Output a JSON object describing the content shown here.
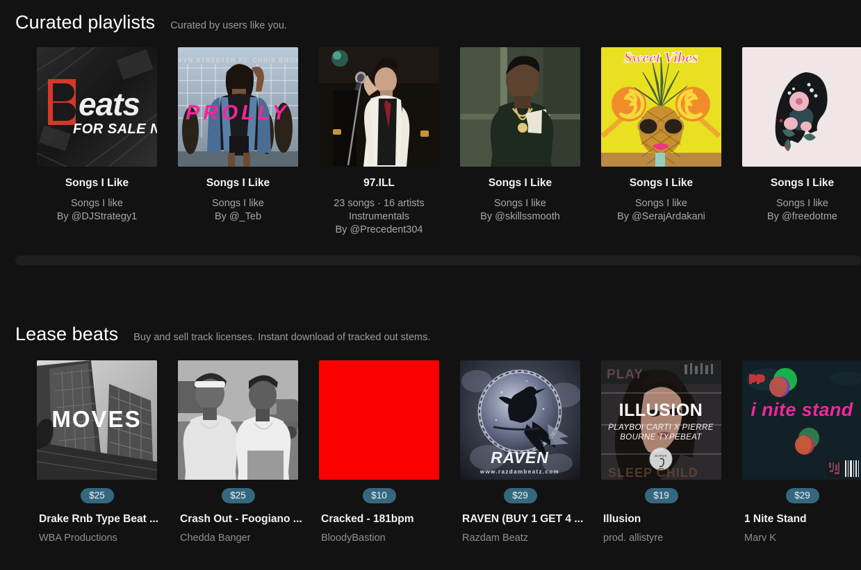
{
  "sections": {
    "curated": {
      "title": "Curated playlists",
      "subtitle": "Curated by users like you."
    },
    "lease": {
      "title": "Lease beats",
      "subtitle": "Buy and sell track licenses. Instant download of tracked out stems."
    }
  },
  "playlists": [
    {
      "title": "Songs I Like",
      "meta_line1": "Songs I like",
      "meta_line2": "By @DJStrategy1",
      "meta_line3": "",
      "art_name": "beats-for-sale-now-cover",
      "art_text": "Beats FOR SALE NOW"
    },
    {
      "title": "Songs I Like",
      "meta_line1": "Songs I like",
      "meta_line2": "By @_Teb",
      "meta_line3": "",
      "art_name": "prolly-sevyn-streeter-cover",
      "art_text": "PROLLY"
    },
    {
      "title": "97.ILL",
      "meta_line1": "23 songs · 16 artists",
      "meta_line2": "Instrumentals",
      "meta_line3": "By @Precedent304",
      "art_name": "singer-with-microphone-cover",
      "art_text": ""
    },
    {
      "title": "Songs I Like",
      "meta_line1": "Songs I like",
      "meta_line2": "By @skillssmooth",
      "meta_line3": "",
      "art_name": "rapper-with-cash-cover",
      "art_text": ""
    },
    {
      "title": "Songs I Like",
      "meta_line1": "Songs I like",
      "meta_line2": "By @SerajArdakani",
      "meta_line3": "",
      "art_name": "sweet-vibes-pineapple-cover",
      "art_text": "Sweet Vibes"
    },
    {
      "title": "Songs I Like",
      "meta_line1": "Songs I like",
      "meta_line2": "By @freedotme",
      "meta_line3": "",
      "art_name": "floral-silhouette-cover",
      "art_text": ""
    }
  ],
  "beats": [
    {
      "price": "$25",
      "title": "Drake Rnb Type Beat ...",
      "artist": "WBA Productions",
      "art_name": "moves-skyscraper-cover",
      "art_text": "MOVES"
    },
    {
      "price": "$25",
      "title": "Crash Out - Foogiano ...",
      "artist": "Chedda Banger",
      "art_name": "two-rappers-photo-cover",
      "art_text": ""
    },
    {
      "price": "$10",
      "title": "Cracked - 181bpm",
      "artist": "BloodyBastion",
      "art_name": "solid-red-cover",
      "art_text": ""
    },
    {
      "price": "$29",
      "title": "RAVEN (BUY 1 GET 4 ...",
      "artist": "Razdam Beatz",
      "art_name": "raven-circle-cover",
      "art_text": "RAVEN"
    },
    {
      "price": "$19",
      "title": "Illusion",
      "artist": "prod. allistyre",
      "art_name": "illusion-playboi-carti-typebeat-cover",
      "art_text": "ILLUSION"
    },
    {
      "price": "$29",
      "title": "1 Nite Stand",
      "artist": "Marv K",
      "art_name": "1-nite-stand-neon-cover",
      "art_text": "i nite stand"
    }
  ],
  "colors": {
    "background": "#121212",
    "price_badge": "#35687f",
    "title_text": "#f2f2f2",
    "muted_text": "#9a9a9a",
    "scrollbar_track": "#1f1f1f"
  }
}
